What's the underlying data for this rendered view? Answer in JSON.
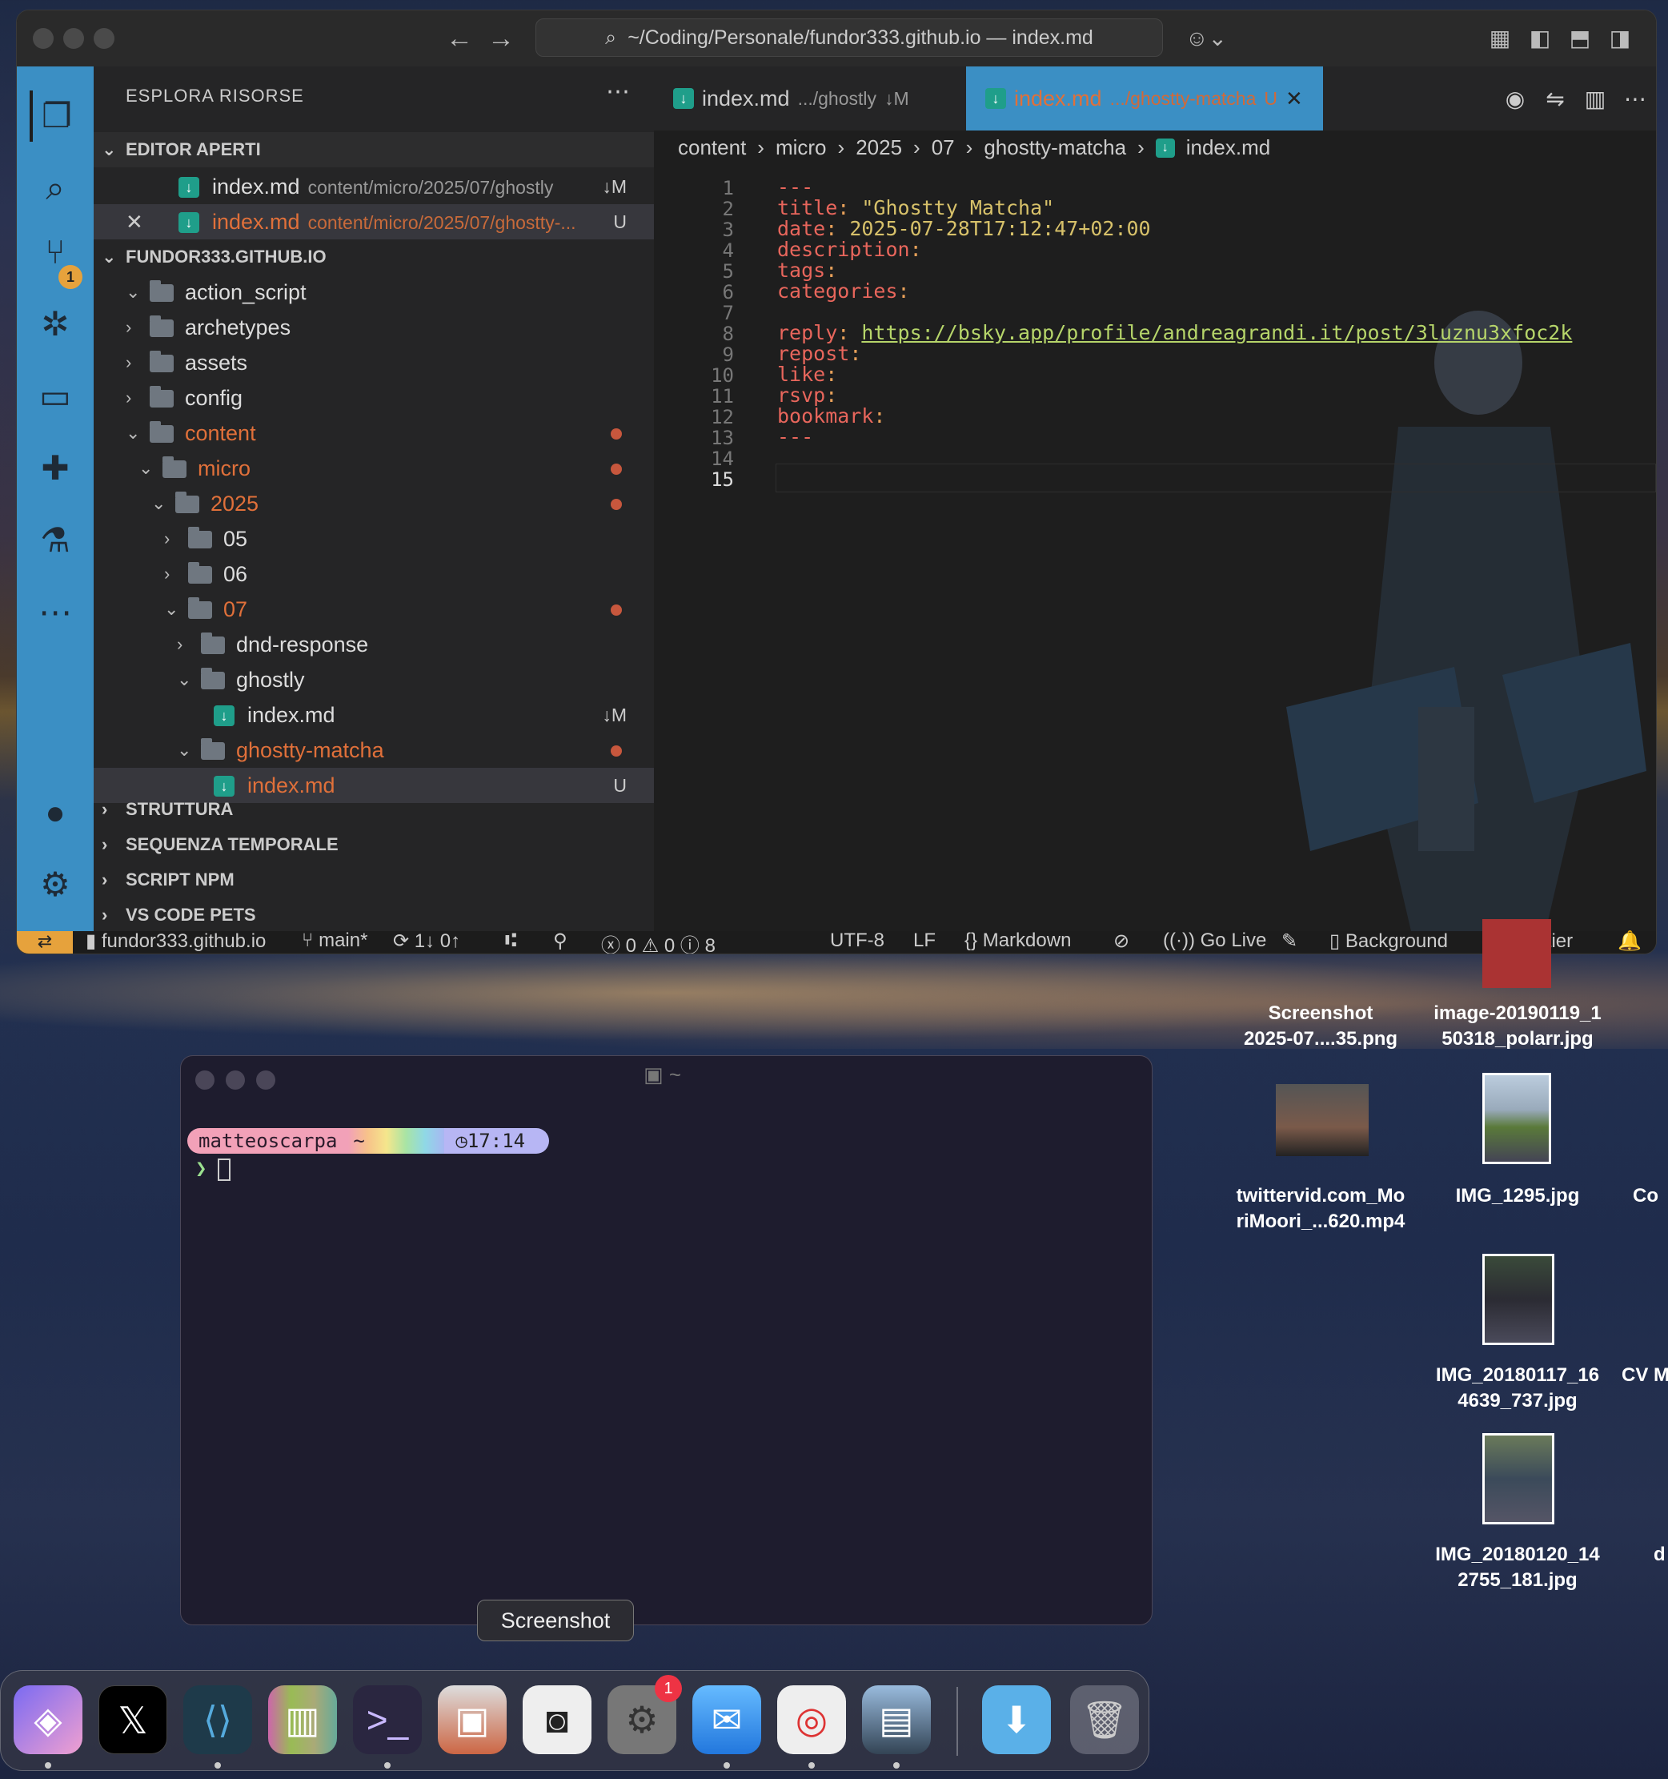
{
  "vscode": {
    "command_center": "~/Coding/Personale/fundor333.github.io — index.md",
    "sidebar": {
      "title": "ESPLORA RISORSE",
      "open_editors_header": "EDITOR APERTI",
      "open_editors": [
        {
          "name": "index.md",
          "path": "content/micro/2025/07/ghostly",
          "status": "↓M"
        },
        {
          "name": "index.md",
          "path": "content/micro/2025/07/ghostty-...",
          "status": "U"
        }
      ],
      "project_header": "FUNDOR333.GITHUB.IO",
      "tree": [
        "action_script",
        "archetypes",
        "assets",
        "config",
        "content",
        "micro",
        "2025",
        "05",
        "06",
        "07",
        "dnd-response",
        "ghostly",
        "index.md",
        "ghostty-matcha",
        "index.md"
      ],
      "tree_status": {
        "ghostly_index": "↓M",
        "matcha_index": "U"
      },
      "sections": [
        "STRUTTURA",
        "SEQUENZA TEMPORALE",
        "SCRIPT NPM",
        "VS CODE PETS"
      ]
    },
    "scm_badge": "1",
    "tabs": [
      {
        "name": "index.md",
        "path": ".../ghostly",
        "status": "↓M"
      },
      {
        "name": "index.md",
        "path": ".../ghostty-matcha",
        "status": "U"
      }
    ],
    "breadcrumb": [
      "content",
      "micro",
      "2025",
      "07",
      "ghostty-matcha",
      "index.md"
    ],
    "lines": [
      "1",
      "2",
      "3",
      "4",
      "5",
      "6",
      "7",
      "8",
      "9",
      "10",
      "11",
      "12",
      "13",
      "14",
      "15"
    ],
    "code": {
      "l1": "---",
      "title_key": "title",
      "title_val": "\"Ghostty Matcha\"",
      "date_key": "date",
      "date_val": "2025-07-28T17:12:47+02:00",
      "desc_key": "description",
      "tags_key": "tags",
      "cat_key": "categories",
      "reply_key": "reply",
      "reply_val": "https://bsky.app/profile/andreagrandi.it/post/3luznu3xfoc2k",
      "repost_key": "repost",
      "like_key": "like",
      "rsvp_key": "rsvp",
      "bookmark_key": "bookmark",
      "l13": "---"
    },
    "status": {
      "repo": "fundor333.github.io",
      "branch": "main*",
      "sync": "1↓ 0↑",
      "errors": "0",
      "warnings": "0",
      "infos": "8",
      "encoding": "UTF-8",
      "eol": "LF",
      "language": "Markdown",
      "golive": "Go Live",
      "background": "Background",
      "prettier": "Prettier"
    }
  },
  "terminal": {
    "title": "~",
    "user": "matteoscarpa",
    "dir": "~",
    "time": "17:14",
    "cursor": "❯"
  },
  "desktop": {
    "files": [
      {
        "l1": "Screenshot",
        "l2": "2025-07....35.png"
      },
      {
        "l1": "image-20190119_1",
        "l2": "50318_polarr.jpg"
      },
      {
        "l1": "twittervid.com_Mo",
        "l2": "riMoori_...620.mp4"
      },
      {
        "l1": "IMG_1295.jpg",
        "l2": ""
      },
      {
        "l1": "IMG_20180117_16",
        "l2": "4639_737.jpg"
      },
      {
        "l1": "IMG_20180120_14",
        "l2": "2755_181.jpg"
      }
    ],
    "partial": [
      "Co",
      "CV M",
      "d"
    ]
  },
  "dock": {
    "tooltip": "Screenshot",
    "notification_badge": "1"
  }
}
